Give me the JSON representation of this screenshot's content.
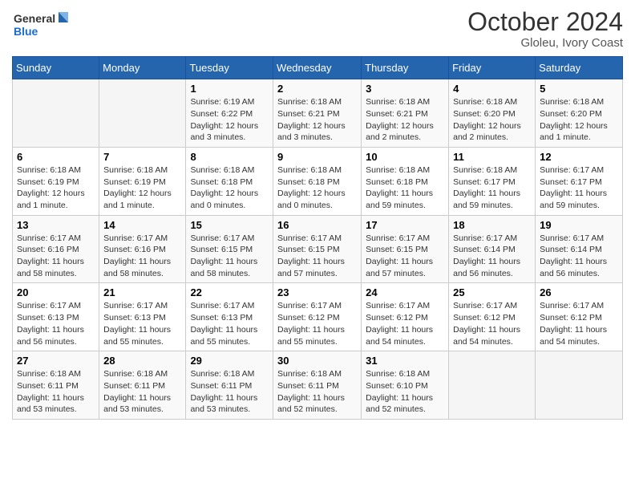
{
  "logo": {
    "line1": "General",
    "line2": "Blue"
  },
  "title": "October 2024",
  "location": "Gloleu, Ivory Coast",
  "days_header": [
    "Sunday",
    "Monday",
    "Tuesday",
    "Wednesday",
    "Thursday",
    "Friday",
    "Saturday"
  ],
  "weeks": [
    [
      {
        "day": "",
        "info": ""
      },
      {
        "day": "",
        "info": ""
      },
      {
        "day": "1",
        "info": "Sunrise: 6:19 AM\nSunset: 6:22 PM\nDaylight: 12 hours and 3 minutes."
      },
      {
        "day": "2",
        "info": "Sunrise: 6:18 AM\nSunset: 6:21 PM\nDaylight: 12 hours and 3 minutes."
      },
      {
        "day": "3",
        "info": "Sunrise: 6:18 AM\nSunset: 6:21 PM\nDaylight: 12 hours and 2 minutes."
      },
      {
        "day": "4",
        "info": "Sunrise: 6:18 AM\nSunset: 6:20 PM\nDaylight: 12 hours and 2 minutes."
      },
      {
        "day": "5",
        "info": "Sunrise: 6:18 AM\nSunset: 6:20 PM\nDaylight: 12 hours and 1 minute."
      }
    ],
    [
      {
        "day": "6",
        "info": "Sunrise: 6:18 AM\nSunset: 6:19 PM\nDaylight: 12 hours and 1 minute."
      },
      {
        "day": "7",
        "info": "Sunrise: 6:18 AM\nSunset: 6:19 PM\nDaylight: 12 hours and 1 minute."
      },
      {
        "day": "8",
        "info": "Sunrise: 6:18 AM\nSunset: 6:18 PM\nDaylight: 12 hours and 0 minutes."
      },
      {
        "day": "9",
        "info": "Sunrise: 6:18 AM\nSunset: 6:18 PM\nDaylight: 12 hours and 0 minutes."
      },
      {
        "day": "10",
        "info": "Sunrise: 6:18 AM\nSunset: 6:18 PM\nDaylight: 11 hours and 59 minutes."
      },
      {
        "day": "11",
        "info": "Sunrise: 6:18 AM\nSunset: 6:17 PM\nDaylight: 11 hours and 59 minutes."
      },
      {
        "day": "12",
        "info": "Sunrise: 6:17 AM\nSunset: 6:17 PM\nDaylight: 11 hours and 59 minutes."
      }
    ],
    [
      {
        "day": "13",
        "info": "Sunrise: 6:17 AM\nSunset: 6:16 PM\nDaylight: 11 hours and 58 minutes."
      },
      {
        "day": "14",
        "info": "Sunrise: 6:17 AM\nSunset: 6:16 PM\nDaylight: 11 hours and 58 minutes."
      },
      {
        "day": "15",
        "info": "Sunrise: 6:17 AM\nSunset: 6:15 PM\nDaylight: 11 hours and 58 minutes."
      },
      {
        "day": "16",
        "info": "Sunrise: 6:17 AM\nSunset: 6:15 PM\nDaylight: 11 hours and 57 minutes."
      },
      {
        "day": "17",
        "info": "Sunrise: 6:17 AM\nSunset: 6:15 PM\nDaylight: 11 hours and 57 minutes."
      },
      {
        "day": "18",
        "info": "Sunrise: 6:17 AM\nSunset: 6:14 PM\nDaylight: 11 hours and 56 minutes."
      },
      {
        "day": "19",
        "info": "Sunrise: 6:17 AM\nSunset: 6:14 PM\nDaylight: 11 hours and 56 minutes."
      }
    ],
    [
      {
        "day": "20",
        "info": "Sunrise: 6:17 AM\nSunset: 6:13 PM\nDaylight: 11 hours and 56 minutes."
      },
      {
        "day": "21",
        "info": "Sunrise: 6:17 AM\nSunset: 6:13 PM\nDaylight: 11 hours and 55 minutes."
      },
      {
        "day": "22",
        "info": "Sunrise: 6:17 AM\nSunset: 6:13 PM\nDaylight: 11 hours and 55 minutes."
      },
      {
        "day": "23",
        "info": "Sunrise: 6:17 AM\nSunset: 6:12 PM\nDaylight: 11 hours and 55 minutes."
      },
      {
        "day": "24",
        "info": "Sunrise: 6:17 AM\nSunset: 6:12 PM\nDaylight: 11 hours and 54 minutes."
      },
      {
        "day": "25",
        "info": "Sunrise: 6:17 AM\nSunset: 6:12 PM\nDaylight: 11 hours and 54 minutes."
      },
      {
        "day": "26",
        "info": "Sunrise: 6:17 AM\nSunset: 6:12 PM\nDaylight: 11 hours and 54 minutes."
      }
    ],
    [
      {
        "day": "27",
        "info": "Sunrise: 6:18 AM\nSunset: 6:11 PM\nDaylight: 11 hours and 53 minutes."
      },
      {
        "day": "28",
        "info": "Sunrise: 6:18 AM\nSunset: 6:11 PM\nDaylight: 11 hours and 53 minutes."
      },
      {
        "day": "29",
        "info": "Sunrise: 6:18 AM\nSunset: 6:11 PM\nDaylight: 11 hours and 53 minutes."
      },
      {
        "day": "30",
        "info": "Sunrise: 6:18 AM\nSunset: 6:11 PM\nDaylight: 11 hours and 52 minutes."
      },
      {
        "day": "31",
        "info": "Sunrise: 6:18 AM\nSunset: 6:10 PM\nDaylight: 11 hours and 52 minutes."
      },
      {
        "day": "",
        "info": ""
      },
      {
        "day": "",
        "info": ""
      }
    ]
  ]
}
